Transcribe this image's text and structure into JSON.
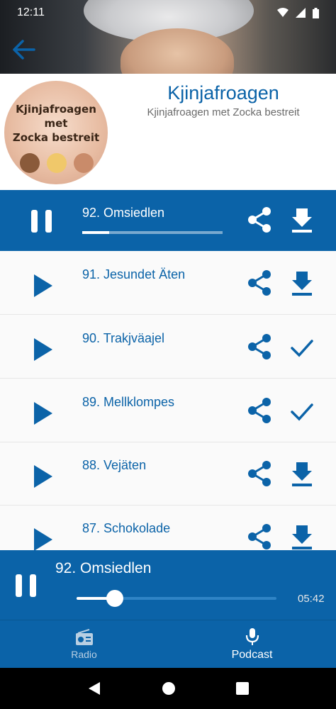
{
  "status_bar": {
    "time": "12:11"
  },
  "podcast": {
    "title": "Kjinjafroagen",
    "subtitle": "Kjinjafroagen met Zocka bestreit",
    "cover_text": [
      "Kjinjafroagen",
      "met",
      "Zocka bestreit"
    ]
  },
  "episodes": [
    {
      "title": "92. Omsiedlen",
      "state": "playing",
      "progress": 0.19,
      "download": "download-icon"
    },
    {
      "title": "91. Jesundet Äten",
      "state": "idle",
      "download": "download-icon"
    },
    {
      "title": "90. Trakjväajel",
      "state": "idle",
      "download": "check-icon"
    },
    {
      "title": "89. Mellklompes",
      "state": "idle",
      "download": "check-icon"
    },
    {
      "title": "88. Vejäten",
      "state": "idle",
      "download": "download-icon"
    },
    {
      "title": "87. Schokolade",
      "state": "idle",
      "download": "download-icon"
    }
  ],
  "player": {
    "title": "92. Omsiedlen",
    "duration": "05:42",
    "progress": 0.19
  },
  "bottom_nav": {
    "items": [
      {
        "label": "Radio",
        "icon": "radio-icon",
        "active": false
      },
      {
        "label": "Podcast",
        "icon": "microphone-icon",
        "active": true
      }
    ]
  },
  "colors": {
    "accent": "#0b63a8",
    "row_background": "#fafafa",
    "subtitle": "#6a6a6a"
  }
}
